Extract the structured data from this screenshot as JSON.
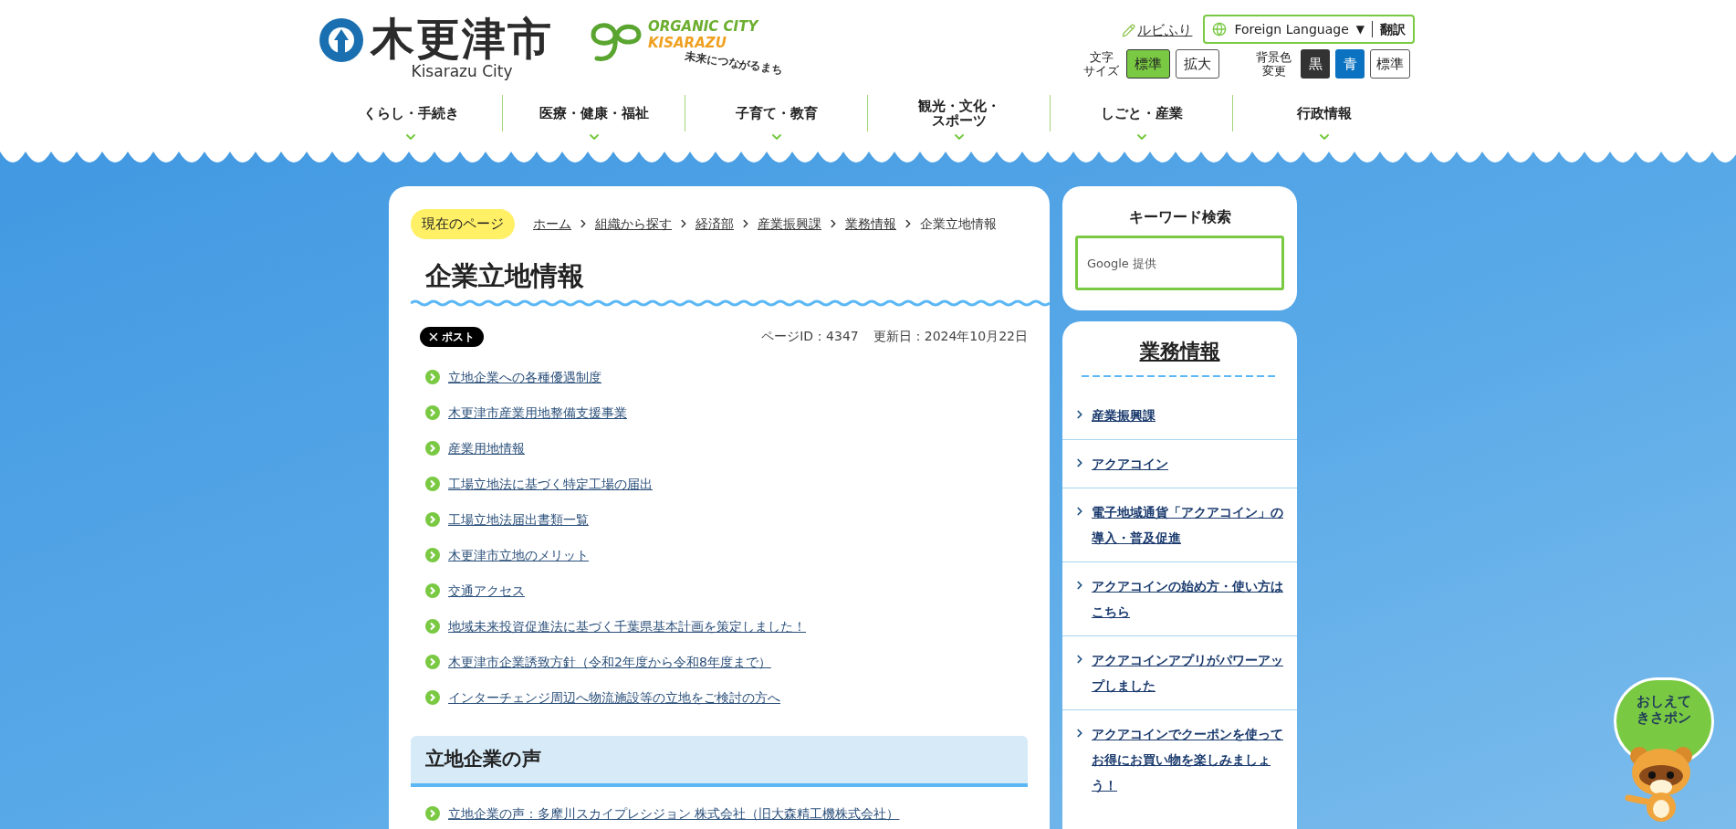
{
  "header": {
    "city_name": "木更津市",
    "city_name_en": "Kisarazu City",
    "organic": {
      "line1": "ORGANIC CITY",
      "line2": "KISARAZU",
      "tagline": "未来につながるまち"
    },
    "ruby_link": "ルビふり",
    "language": {
      "label": "Foreign Language",
      "caret": "▼",
      "button": "翻訳"
    },
    "font_size": {
      "label": [
        "文字",
        "サイズ"
      ],
      "options": [
        {
          "label": "標準",
          "selected": true
        },
        {
          "label": "拡大",
          "selected": false
        }
      ]
    },
    "bg_color": {
      "label": [
        "背景色",
        "変更"
      ],
      "options": [
        {
          "label": "黒",
          "color": "#333333"
        },
        {
          "label": "青",
          "color": "#0a72c0"
        },
        {
          "label": "標準",
          "color": "#ffffff"
        }
      ]
    }
  },
  "nav": [
    [
      "くらし・手続き"
    ],
    [
      "医療・健康・福祉"
    ],
    [
      "子育て・教育"
    ],
    [
      "観光・文化・",
      "スポーツ"
    ],
    [
      "しごと・産業"
    ],
    [
      "行政情報"
    ]
  ],
  "breadcrumb": {
    "badge": "現在のページ",
    "items": [
      {
        "label": "ホーム",
        "link": true
      },
      {
        "label": "組織から探す",
        "link": true
      },
      {
        "label": "経済部",
        "link": true
      },
      {
        "label": "産業振興課",
        "link": true
      },
      {
        "label": "業務情報",
        "link": true
      },
      {
        "label": "企業立地情報",
        "link": false
      }
    ]
  },
  "title": "企業立地情報",
  "share": "ポスト",
  "page_id": "ページID：4347",
  "updated": "更新日：2024年10月22日",
  "links": [
    "立地企業への各種優遇制度",
    "木更津市産業用地整備支援事業",
    "産業用地情報",
    "工場立地法に基づく特定工場の届出",
    "工場立地法届出書類一覧",
    "木更津市立地のメリット",
    "交通アクセス",
    "地域未来投資促進法に基づく千葉県基本計画を策定しました！",
    "木更津市企業誘致方針（令和2年度から令和8年度まで）",
    "インターチェンジ周辺へ物流施設等の立地をご検討の方へ"
  ],
  "section": {
    "heading": "立地企業の声",
    "links": [
      "立地企業の声：多摩川スカイプレシジョン 株式会社（旧大森精工機株式会社）"
    ]
  },
  "search": {
    "heading": "キーワード検索",
    "placeholder": "Google 提供"
  },
  "category": {
    "heading": "業務情報",
    "items": [
      "産業振興課",
      "アクアコイン",
      "電子地域通貨「アクアコイン」の導入・普及促進",
      "アクアコインの始め方・使い方はこちら",
      "アクアコインアプリがパワーアップしました",
      "アクアコインでクーポンを使ってお得にお買い物を楽しみましょう！"
    ]
  },
  "mascot": {
    "text": "おしえてきさポン"
  }
}
